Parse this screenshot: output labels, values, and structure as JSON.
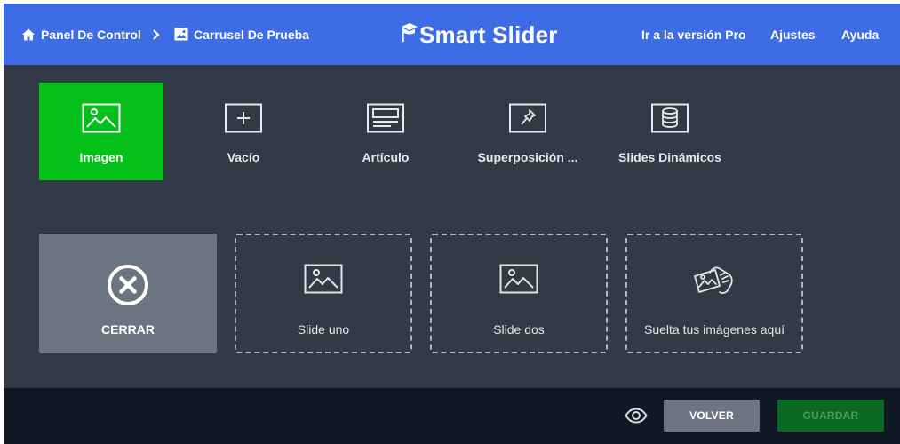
{
  "header": {
    "breadcrumb_home": "Panel De Control",
    "breadcrumb_current": "Carrusel De Prueba",
    "logo_text": "Smart Slider",
    "nav": {
      "pro": "Ir a la versión Pro",
      "ajustes": "Ajustes",
      "ayuda": "Ayuda"
    }
  },
  "types": [
    {
      "label": "Imagen",
      "icon": "image-icon"
    },
    {
      "label": "Vacío",
      "icon": "plus-box-icon"
    },
    {
      "label": "Artículo",
      "icon": "article-icon"
    },
    {
      "label": "Superposición ...",
      "icon": "pin-icon"
    },
    {
      "label": "Slides Dinámicos",
      "icon": "database-icon"
    }
  ],
  "cards": {
    "close": "CERRAR",
    "slide1": "Slide uno",
    "slide2": "Slide dos",
    "drop": "Suelta tus imágenes aquí"
  },
  "footer": {
    "back": "VOLVER",
    "save": "GUARDAR"
  },
  "colors": {
    "header_bg": "#3e6ce4",
    "body_bg": "#323a45",
    "active_tile": "#04c018",
    "footer_bg": "#0f1823",
    "save_button": "#0a6a24"
  }
}
